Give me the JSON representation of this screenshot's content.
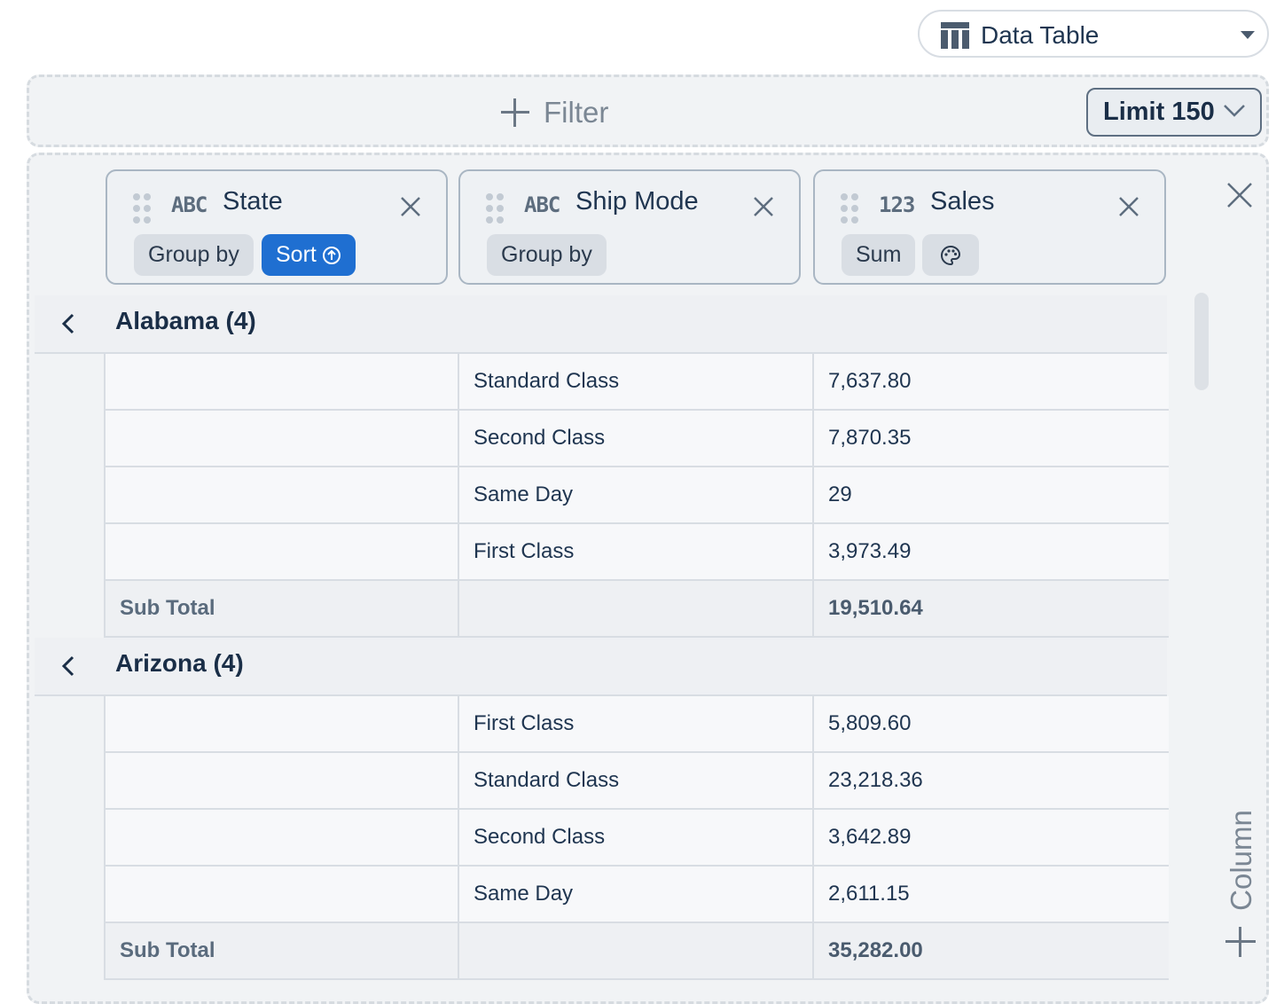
{
  "view_selector": {
    "label": "Data Table"
  },
  "filter": {
    "add_label": "Filter",
    "limit_label": "Limit 150"
  },
  "columns": [
    {
      "type": "ABC",
      "name": "State",
      "pills": [
        "Group by",
        "Sort"
      ]
    },
    {
      "type": "ABC",
      "name": "Ship Mode",
      "pills": [
        "Group by"
      ]
    },
    {
      "type": "123",
      "name": "Sales",
      "pills": [
        "Sum"
      ]
    }
  ],
  "add_column_label": "Column",
  "groups": [
    {
      "title": "Alabama (4)",
      "rows": [
        {
          "ship_mode": "Standard Class",
          "sales": "7,637.80"
        },
        {
          "ship_mode": "Second Class",
          "sales": "7,870.35"
        },
        {
          "ship_mode": "Same Day",
          "sales": "29"
        },
        {
          "ship_mode": "First Class",
          "sales": "3,973.49"
        }
      ],
      "subtotal_label": "Sub Total",
      "subtotal": "19,510.64"
    },
    {
      "title": "Arizona (4)",
      "rows": [
        {
          "ship_mode": "First Class",
          "sales": "5,809.60"
        },
        {
          "ship_mode": "Standard Class",
          "sales": "23,218.36"
        },
        {
          "ship_mode": "Second Class",
          "sales": "3,642.89"
        },
        {
          "ship_mode": "Same Day",
          "sales": "2,611.15"
        }
      ],
      "subtotal_label": "Sub Total",
      "subtotal": "35,282.00"
    }
  ],
  "colors": {
    "accent": "#1f6fd1",
    "text": "#1f3550",
    "muted": "#7b8794"
  }
}
